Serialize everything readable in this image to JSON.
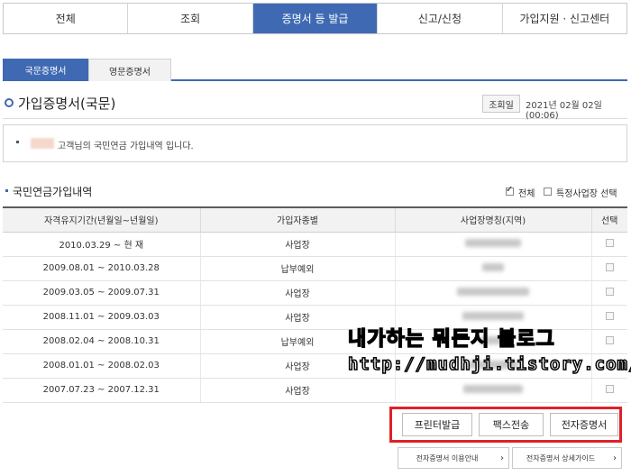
{
  "topnav": {
    "tabs": [
      "전체",
      "조회",
      "증명서 등 발급",
      "신고/신청",
      "가입지원 · 신고센터"
    ],
    "active_index": 2
  },
  "subtabs": {
    "korean": "국문증명서",
    "english": "영문증명서"
  },
  "header": {
    "title": "가입증명서(국문)",
    "inquiry_label": "조회일",
    "inquiry_date": "2021년 02월 02일 (00:06)"
  },
  "notice": {
    "message": "고객님의 국민연금 가입내역 입니다."
  },
  "section": {
    "title": "국민연금가입내역",
    "check_all_label": "전체",
    "check_specific_label": "특정사업장 선택"
  },
  "table": {
    "headers": [
      "자격유지기간(년월일~년월일)",
      "가입자종별",
      "사업장명칭(지역)",
      "선택"
    ],
    "rows": [
      {
        "period": "2010.03.29 ~ 현 재",
        "type": "사업장"
      },
      {
        "period": "2009.08.01 ~ 2010.03.28",
        "type": "납부예외"
      },
      {
        "period": "2009.03.05 ~ 2009.07.31",
        "type": "사업장"
      },
      {
        "period": "2008.11.01 ~ 2009.03.03",
        "type": "사업장"
      },
      {
        "period": "2008.02.04 ~ 2008.10.31",
        "type": "납부예외"
      },
      {
        "period": "2008.01.01 ~ 2008.02.03",
        "type": "사업장"
      },
      {
        "period": "2007.07.23 ~ 2007.12.31",
        "type": "사업장"
      }
    ]
  },
  "watermark": {
    "line1": "내가하는 뭐든지 블로그",
    "line2": "http://mudhji.tistory.com/"
  },
  "buttons": {
    "print": "프린터발급",
    "fax": "팩스전송",
    "electronic": "전자증명서"
  },
  "guides": {
    "usage": "전자증명서 이용안내",
    "detail": "전자증명서 상세가이드"
  },
  "colors": {
    "accent": "#3f6ab3",
    "highlight_box": "#e0202a"
  }
}
